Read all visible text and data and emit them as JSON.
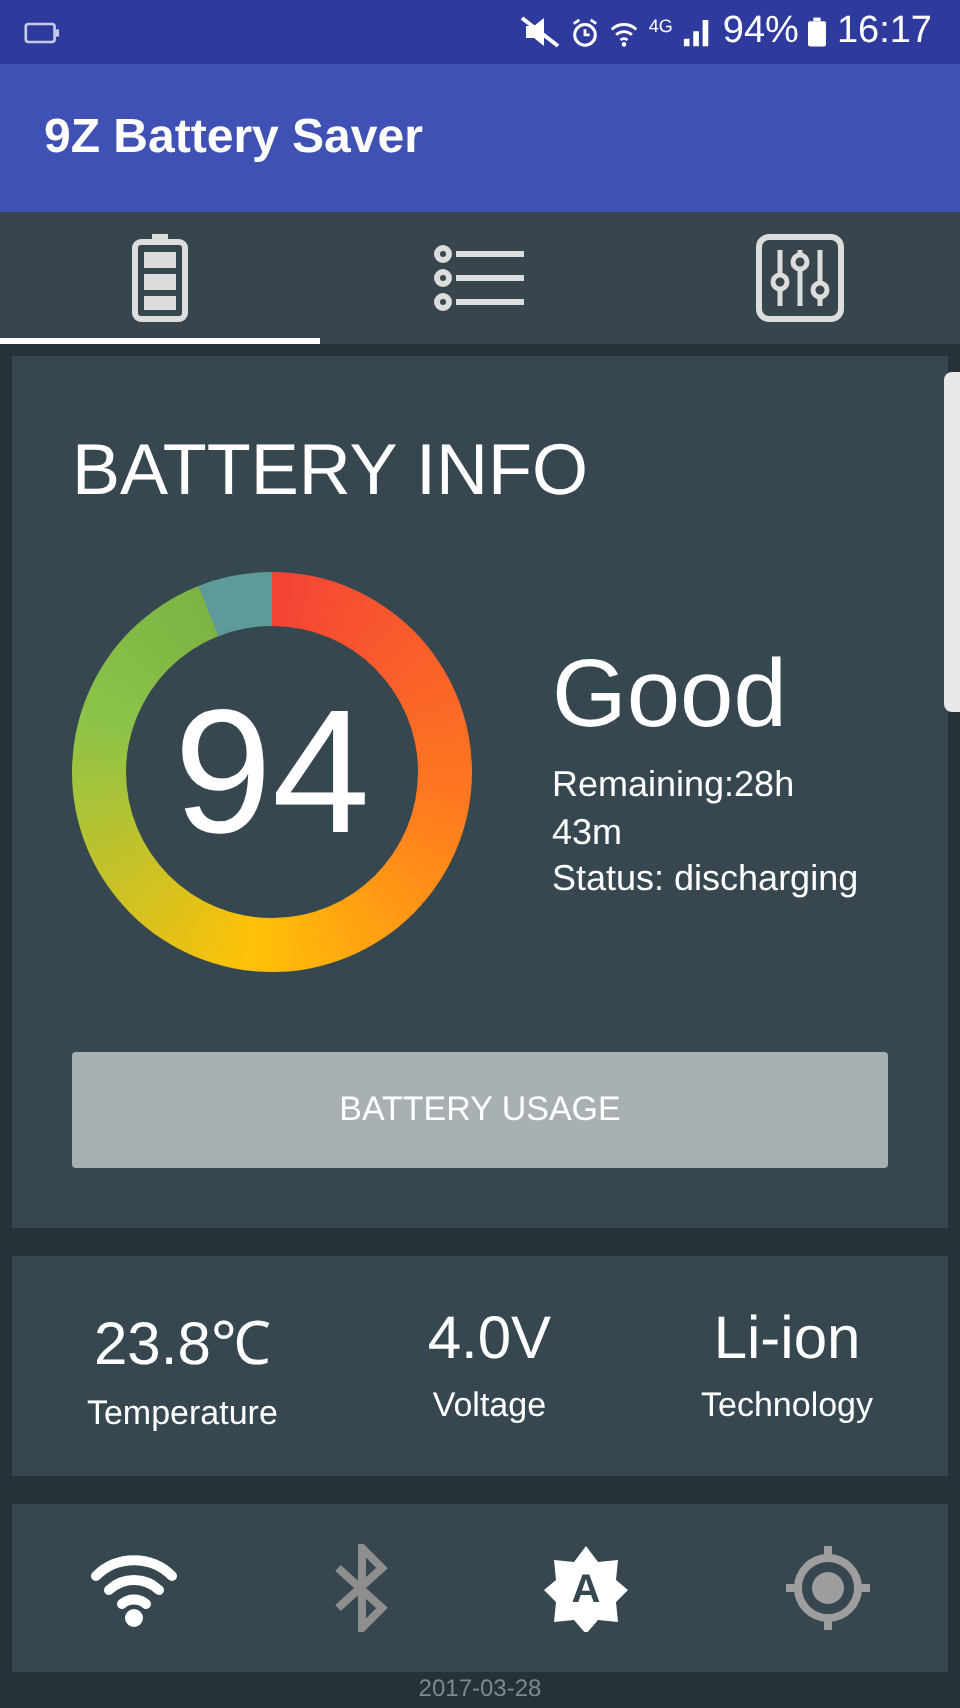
{
  "status_bar": {
    "network": "4G",
    "battery": "94%",
    "time": "16:17"
  },
  "app_bar": {
    "title": "9Z Battery Saver"
  },
  "tabs": [
    {
      "kind": "battery",
      "selected": true
    },
    {
      "kind": "list",
      "selected": false
    },
    {
      "kind": "sliders",
      "selected": false
    }
  ],
  "battery_info": {
    "title": "BATTERY INFO",
    "percent": "94",
    "health": "Good",
    "remaining": "Remaining:28h 43m",
    "status": "Status: discharging",
    "button": "BATTERY USAGE"
  },
  "stats": [
    {
      "value": "23.8℃",
      "label": "Temperature"
    },
    {
      "value": "4.0V",
      "label": "Voltage"
    },
    {
      "value": "Li-ion",
      "label": "Technology"
    }
  ],
  "toggles": [
    {
      "kind": "wifi",
      "on": true
    },
    {
      "kind": "bluetooth",
      "on": false
    },
    {
      "kind": "brightness",
      "on": true,
      "label": "A"
    },
    {
      "kind": "location",
      "on": false
    }
  ],
  "date": "2017-03-28"
}
